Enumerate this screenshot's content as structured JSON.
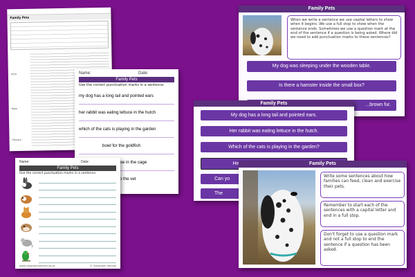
{
  "lesson_plan": {
    "title": "Family Pets",
    "logo": "classroom",
    "side_labels": [
      "Intro",
      "Main",
      "Plenary"
    ]
  },
  "worksheet_b": {
    "name_label": "Name:",
    "date_label": "Date:",
    "title": "Family Pets",
    "instruction": "Use the correct punctuation marks in a sentence.",
    "sentences": [
      "my dog has a long tail and pointed ears",
      "her rabbit was eating lettuce in the hutch",
      "which of the cats is playing in the garden",
      "bowl for the goldfish",
      "grey mouse in the cage",
      "ir parrot to the vet"
    ]
  },
  "worksheet_a": {
    "name_label": "Name:",
    "date_label": "Date:",
    "title": "Family Pets",
    "instruction": "Use the correct punctuation marks in a sentence.",
    "animals": [
      "rabbit",
      "guinea pig",
      "cat",
      "hamster",
      "mouse",
      "parrot"
    ],
    "footer_left": "www.classroomsecrets.co.uk",
    "footer_right": "© Classroom Secrets"
  },
  "slide1": {
    "title": "Family Pets",
    "bubble_text": "When we write a sentence we use capital letters to show when it begins. We use a full stop to show when the sentence ends. Sometimes we use a question mark at the end of the sentence if a question is being asked. Where did we need to add punctuation marks to these sentences?",
    "sentences": [
      "My dog was sleeping under the wooden table.",
      "Is there a hamster inside the small box?",
      "...brown fur."
    ]
  },
  "slide2": {
    "title": "Family Pets",
    "sentences": [
      "My dog has a long tail and pointed ears.",
      "Her rabbit was eating lettuce in the hutch.",
      "Which of the cats is playing in the garden?",
      "He bought a new bowl for the goldfish.",
      "Can yo",
      "The"
    ]
  },
  "slide3": {
    "title": "Family Pets",
    "bubbles": [
      "Write some sentences about how families can feed, clean and exercise their pets.",
      "Remember to start each of the sentences with a capital letter and end in a full stop.",
      "Don't forget to use a question mark and not a full stop to end the sentence if a question has been asked."
    ]
  },
  "colors": {
    "background": "#7b118c",
    "header": "#5b2f7e",
    "pill": "#6a36a4"
  }
}
